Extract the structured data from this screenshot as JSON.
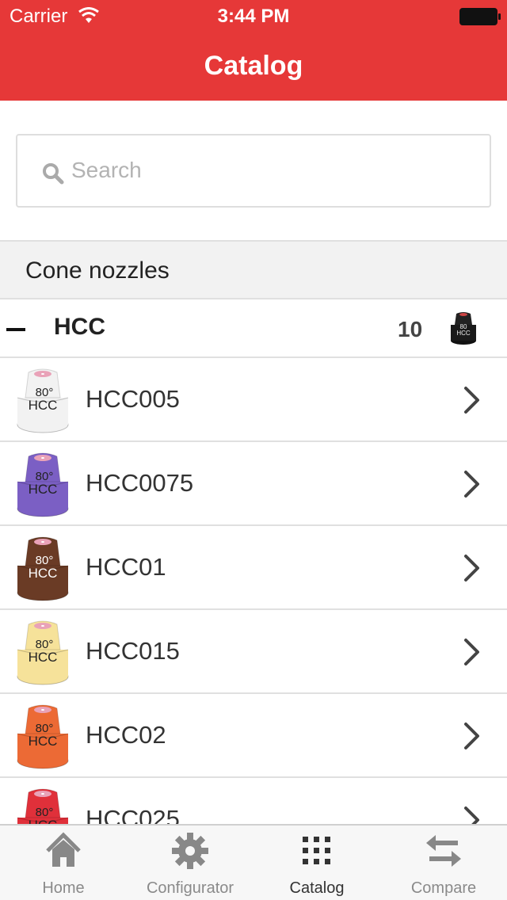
{
  "status_bar": {
    "carrier": "Carrier",
    "time": "3:44 PM"
  },
  "nav": {
    "title": "Catalog"
  },
  "search": {
    "placeholder": "Search"
  },
  "section": {
    "title": "Cone nozzles"
  },
  "group": {
    "name": "HCC",
    "count": "10",
    "icon": "collapse-minus-icon"
  },
  "items": [
    {
      "label": "HCC005",
      "color": "#f2f2f2",
      "text_color": "#222222"
    },
    {
      "label": "HCC0075",
      "color": "#7b5fc4",
      "text_color": "#222222"
    },
    {
      "label": "HCC01",
      "color": "#6a3b25",
      "text_color": "#ffffff"
    },
    {
      "label": "HCC015",
      "color": "#f6e29a",
      "text_color": "#222222"
    },
    {
      "label": "HCC02",
      "color": "#ec6a35",
      "text_color": "#222222"
    },
    {
      "label": "HCC025",
      "color": "#e0303a",
      "text_color": "#222222"
    }
  ],
  "nozzle_text": {
    "angle": "80°",
    "model": "HCC"
  },
  "tabs": [
    {
      "label": "Home",
      "icon": "home-icon"
    },
    {
      "label": "Configurator",
      "icon": "gear-icon"
    },
    {
      "label": "Catalog",
      "icon": "grid-icon",
      "active": true
    },
    {
      "label": "Compare",
      "icon": "swap-arrows-icon"
    }
  ],
  "colors": {
    "brand_red": "#e63838",
    "tab_inactive": "#8a8a8a"
  }
}
